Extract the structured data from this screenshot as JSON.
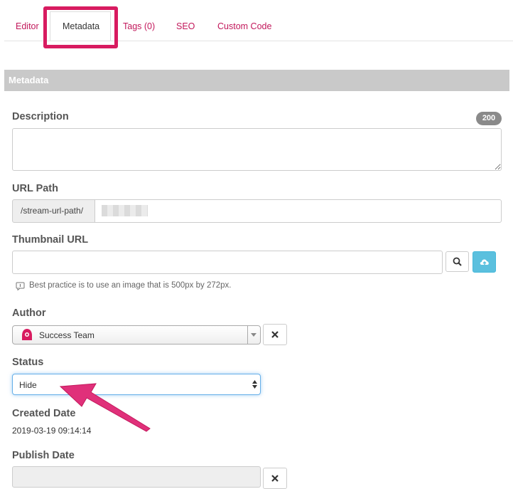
{
  "tabs": [
    {
      "label": "Editor"
    },
    {
      "label": "Metadata"
    },
    {
      "label": "Tags (0)"
    },
    {
      "label": "SEO"
    },
    {
      "label": "Custom Code"
    }
  ],
  "panel": {
    "title": "Metadata"
  },
  "description": {
    "label": "Description",
    "counter": "200",
    "value": ""
  },
  "url_path": {
    "label": "URL Path",
    "prefix": "/stream-url-path/"
  },
  "thumbnail": {
    "label": "Thumbnail URL",
    "value": "",
    "hint": "Best practice is to use an image that is 500px by 272px."
  },
  "author": {
    "label": "Author",
    "selected": "Success Team"
  },
  "status": {
    "label": "Status",
    "selected": "Hide"
  },
  "created": {
    "label": "Created Date",
    "value": "2019-03-19 09:14:14"
  },
  "publish": {
    "label": "Publish Date"
  },
  "colors": {
    "accent": "#d81b60",
    "tab_text": "#c2185b",
    "info_button": "#5bc0de",
    "panel_header": "#c9c9c9"
  },
  "icons": [
    "search-icon",
    "upload-cloud-icon",
    "clear-x-icon",
    "avatar-icon",
    "info-icon",
    "arrow-annotation"
  ]
}
